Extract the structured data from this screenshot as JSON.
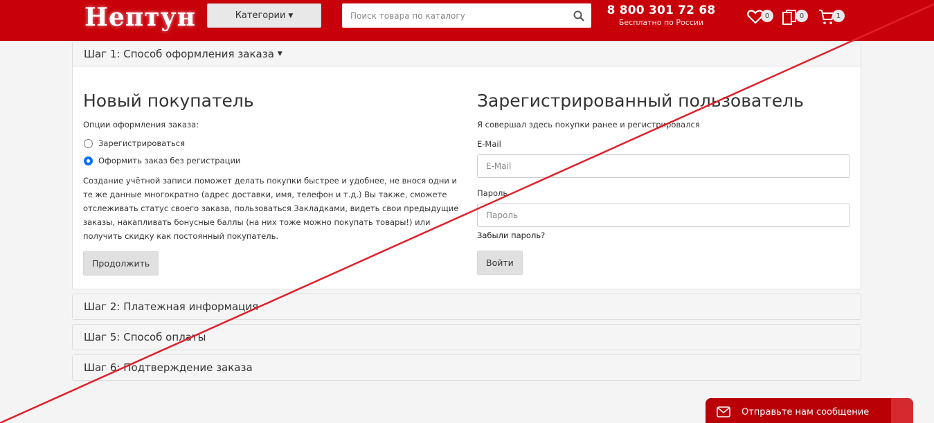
{
  "header": {
    "logo": "Нептун",
    "categories_label": "Категории",
    "search_placeholder": "Поиск товара по каталогу",
    "phone": "8 800 301 72 68",
    "phone_sub": "Бесплатно по России",
    "wishlist_count": "0",
    "compare_count": "0",
    "cart_count": "1",
    "brand_color": "#c8000a"
  },
  "step1": {
    "title": "Шаг 1: Способ оформления заказа",
    "new_customer": {
      "heading": "Новый покупатель",
      "options_label": "Опции оформления заказа:",
      "option_register": "Зарегистрироваться",
      "option_guest": "Оформить заказ без регистрации",
      "selected": "guest",
      "info": "Создание учётной записи поможет делать покупки быстрее и удобнее, не внося одни и те же данные многократно (адрес доставки, имя, телефон и т.д.) Вы также, сможете отслеживать статус своего заказа, пользоваться Закладками, видеть свои предыдущие заказы, накапливать бонусные баллы (на них тоже можно покупать товары!) или получить скидку как постоянный покупатель.",
      "continue_label": "Продолжить"
    },
    "returning_customer": {
      "heading": "Зарегистрированный пользователь",
      "subtitle": "Я совершал здесь покупки ранее и регистрировался",
      "email_label": "E-Mail",
      "email_placeholder": "E-Mail",
      "password_label": "Пароль",
      "password_placeholder": "Пароль",
      "forgot_label": "Забыли пароль?",
      "login_label": "Войти"
    }
  },
  "steps": {
    "step2": "Шаг 2: Платежная информация",
    "step5": "Шаг 5: Способ оплаты",
    "step6": "Шаг 6: Подтверждение заказа"
  },
  "chat": {
    "label": "Отправьте нам сообщение"
  }
}
